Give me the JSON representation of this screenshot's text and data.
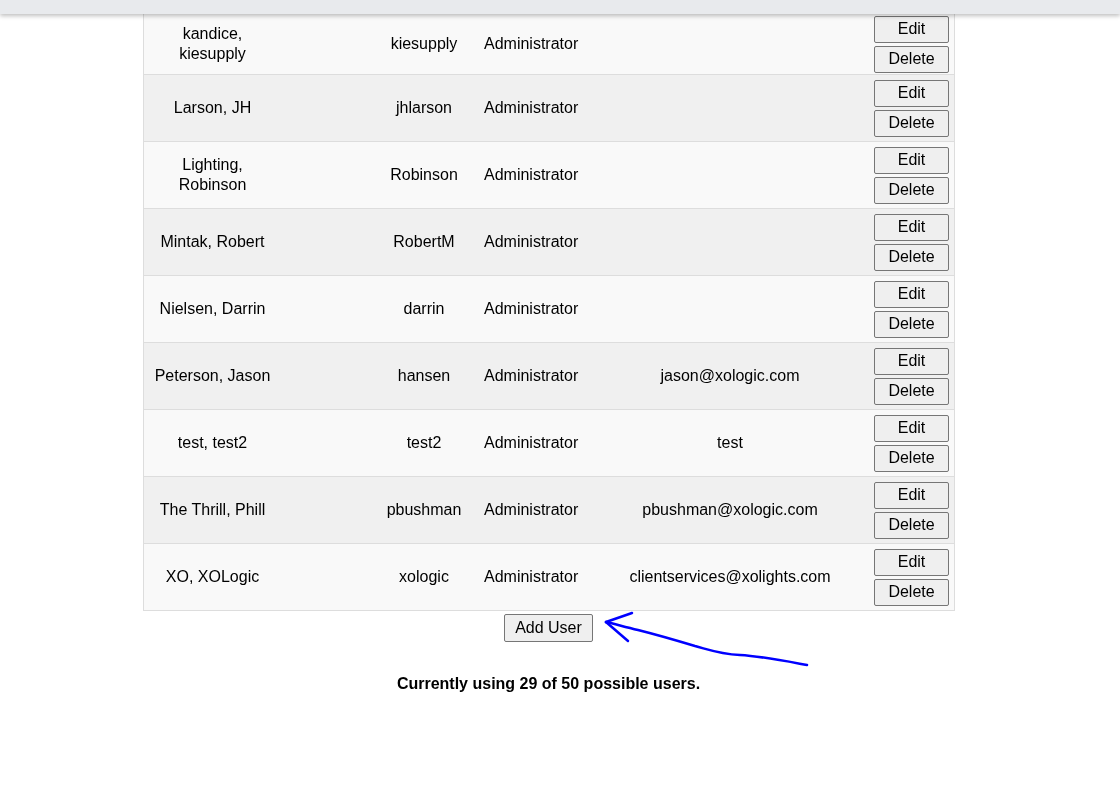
{
  "users": [
    {
      "name": "kandice, kiesupply",
      "username": "kiesupply",
      "role": "Administrator",
      "edit": "Edit",
      "delete": "Delete"
    },
    {
      "name": "Larson, JH",
      "username": "jhlarson",
      "role": "Administrator",
      "edit": "Edit",
      "delete": "Delete"
    },
    {
      "name": "Lighting, Robinson",
      "username": "Robinson",
      "role": "Administrator",
      "edit": "Edit",
      "delete": "Delete"
    },
    {
      "name": "Mintak, Robert",
      "username": "RobertM",
      "role": "Administrator",
      "edit": "Edit",
      "delete": "Delete"
    },
    {
      "name": "Nielsen, Darrin",
      "username": "darrin",
      "role": "Administrator",
      "edit": "Edit",
      "delete": "Delete"
    },
    {
      "name": "Peterson, Jason",
      "username": "hansen",
      "role": "Administrator",
      "email": "jason@xologic.com",
      "edit": "Edit",
      "delete": "Delete"
    },
    {
      "name": "test, test2",
      "username": "test2",
      "role": "Administrator",
      "email": "test",
      "edit": "Edit",
      "delete": "Delete"
    },
    {
      "name": "The Thrill, Phill",
      "username": "pbushman",
      "role": "Administrator",
      "email": "pbushman@xologic.com",
      "edit": "Edit",
      "delete": "Delete"
    },
    {
      "name": "XO, XOLogic",
      "username": "xologic",
      "role": "Administrator",
      "email": "clientservices@xolights.com",
      "edit": "Edit",
      "delete": "Delete"
    }
  ],
  "add_button": "Add User",
  "usage_note": "Currently using 29 of 50 possible users."
}
